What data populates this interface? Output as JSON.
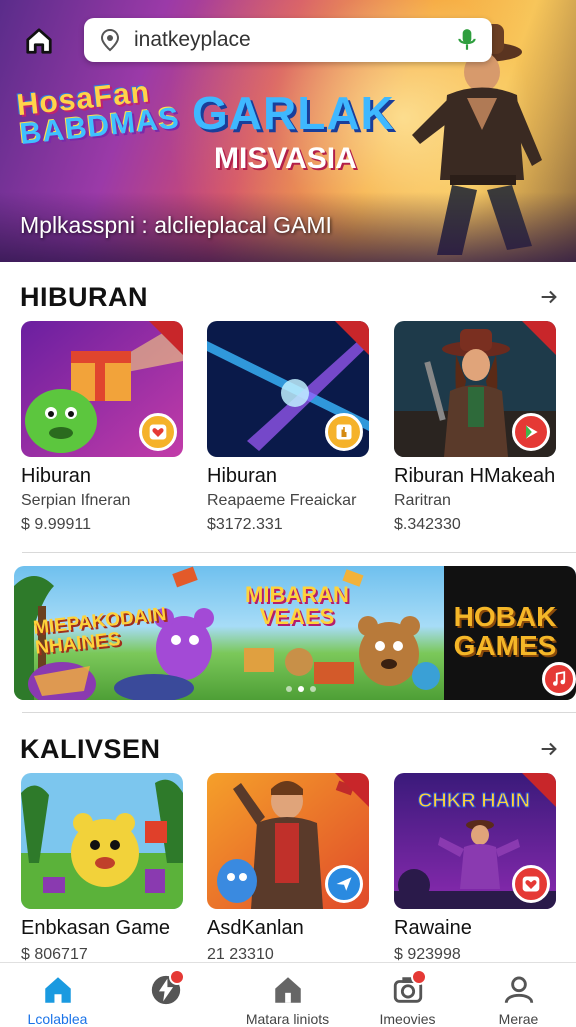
{
  "search": {
    "value": "inatkeyplace"
  },
  "hero": {
    "logo_left_line1": "HosaFan",
    "logo_left_line2": "BABDMAS",
    "logo_main_line1": "GARLAK",
    "logo_main_line2": "MISVASIA",
    "title": "Mplkasspni : alclieplacal GAMI"
  },
  "sections": [
    {
      "title": "HIBURAN",
      "cards": [
        {
          "name": "Hiburan",
          "subtitle": "Serpian Ifneran",
          "price": "$ 9.99911",
          "badge_icon": "heart-icon"
        },
        {
          "name": "Hiburan",
          "subtitle": "Reapaeme Freaickar",
          "price": "$3172.331",
          "badge_icon": "hand-icon"
        },
        {
          "name": "Riburan HMakeah",
          "subtitle": "Raritran",
          "price": "$.342330",
          "badge_icon": "play-icon"
        }
      ]
    },
    {
      "title": "KALIVSEN",
      "cards": [
        {
          "name": "Enbkasan Game",
          "subtitle": "",
          "price": "$ 806717",
          "badge_icon": ""
        },
        {
          "name": "AsdKanlan",
          "subtitle": "",
          "price": "21 23310",
          "badge_icon": "send-icon"
        },
        {
          "name": "Rawaine",
          "subtitle": "",
          "price": "$ 923998",
          "badge_icon": "heart-icon"
        }
      ]
    }
  ],
  "promo_banner": {
    "left_text": "MIEPAKODAIN NHAINES",
    "middle_text": "MIBARAN VEAES",
    "right_text": "HOBAK GAMES"
  },
  "bottom_nav": [
    {
      "label": "Lcolablea",
      "icon": "home-icon",
      "active": true
    },
    {
      "label": "",
      "icon": "lightning-icon",
      "active": false
    },
    {
      "label": "Matara liniots",
      "icon": "house-icon",
      "active": false
    },
    {
      "label": "Imeovies",
      "icon": "camera-icon",
      "active": false
    },
    {
      "label": "Merae",
      "icon": "person-icon",
      "active": false
    }
  ],
  "colors": {
    "accent": "#1a73e8",
    "badge_red": "#e53935",
    "corner_red": "#c8262a"
  }
}
